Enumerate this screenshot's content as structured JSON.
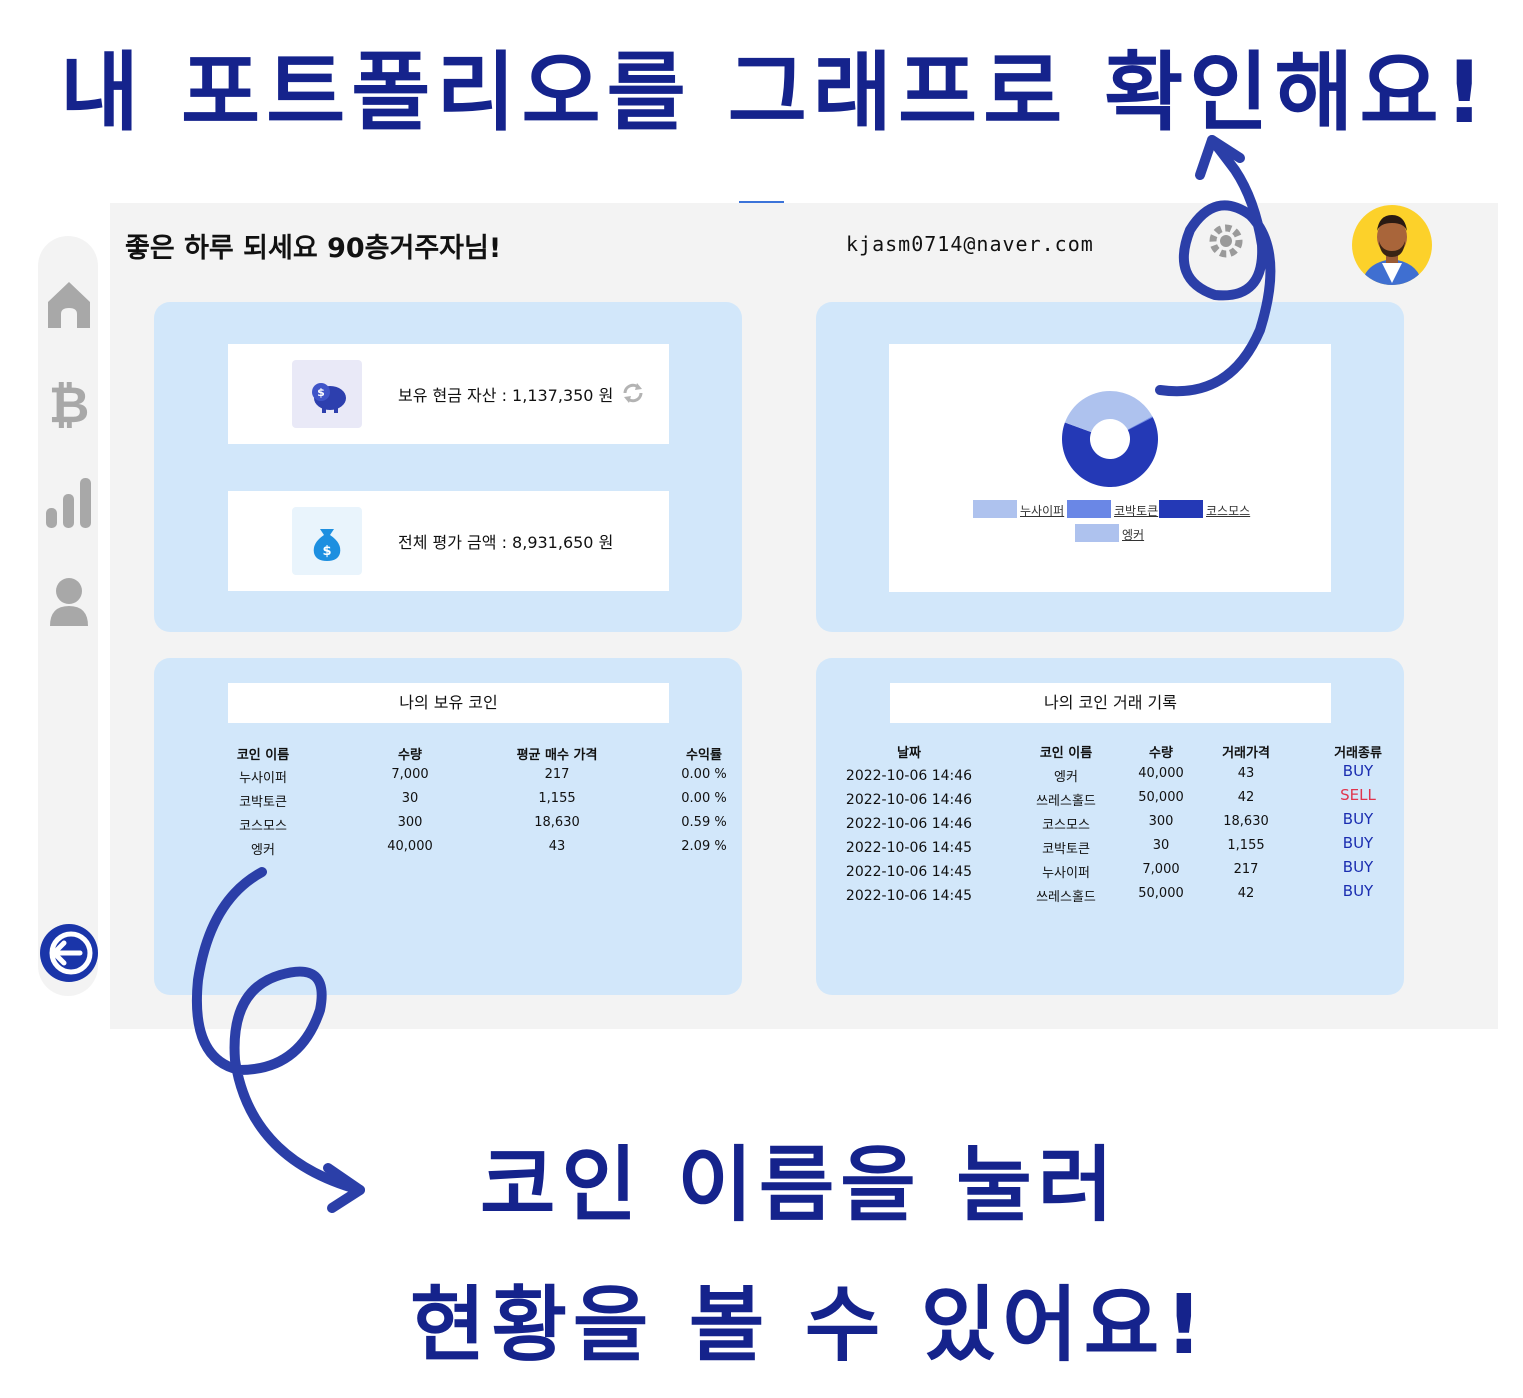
{
  "headlines": {
    "top": "내 포트폴리오를 그래프로 확인해요!",
    "bottom_line1": "코인 이름을 눌러",
    "bottom_line2": "현황을 볼 수 있어요!"
  },
  "header": {
    "greeting": "좋은 하루 되세요 90층거주자님!",
    "email": "kjasm0714@naver.com"
  },
  "sidebar": {
    "items": [
      {
        "icon": "home-icon"
      },
      {
        "icon": "bitcoin-icon"
      },
      {
        "icon": "bar-chart-icon"
      },
      {
        "icon": "user-icon"
      }
    ],
    "logout_icon": "arrow-left-icon"
  },
  "assets": {
    "cash": "보유 현금 자산 : 1,137,350 원",
    "evaluation": "전체 평가 금액 : 8,931,650 원"
  },
  "chart_data": {
    "type": "pie",
    "style": "donut",
    "legend_position": "bottom",
    "labels": [
      "누사이퍼",
      "코박토큰",
      "코스모스",
      "엥커"
    ],
    "values": [
      1519000,
      34650,
      5589000,
      1720000
    ],
    "colors": [
      "#aec2ee",
      "#6a87e6",
      "#2439b6",
      "#aec2ee"
    ]
  },
  "holdings": {
    "title": "나의 보유 코인",
    "columns": [
      "코인 이름",
      "수량",
      "평균 매수 가격",
      "수익률"
    ],
    "rows": [
      [
        "누사이퍼",
        "7,000",
        "217",
        "0.00 %"
      ],
      [
        "코박토큰",
        "30",
        "1,155",
        "0.00 %"
      ],
      [
        "코스모스",
        "300",
        "18,630",
        "0.59 %"
      ],
      [
        "엥커",
        "40,000",
        "43",
        "2.09 %"
      ]
    ]
  },
  "history": {
    "title": "나의 코인 거래 기록",
    "columns": [
      "날짜",
      "코인 이름",
      "수량",
      "거래가격",
      "거래종류"
    ],
    "rows": [
      [
        "2022-10-06 14:46",
        "엥커",
        "40,000",
        "43",
        "BUY"
      ],
      [
        "2022-10-06 14:46",
        "쓰레스홀드",
        "50,000",
        "42",
        "SELL"
      ],
      [
        "2022-10-06 14:46",
        "코스모스",
        "300",
        "18,630",
        "BUY"
      ],
      [
        "2022-10-06 14:45",
        "코박토큰",
        "30",
        "1,155",
        "BUY"
      ],
      [
        "2022-10-06 14:45",
        "누사이퍼",
        "7,000",
        "217",
        "BUY"
      ],
      [
        "2022-10-06 14:45",
        "쓰레스홀드",
        "50,000",
        "42",
        "BUY"
      ]
    ]
  },
  "colors": {
    "accent": "#15238c",
    "panel": "#d2e7fa",
    "buy": "#1a2db0",
    "sell": "#e0344d",
    "sidebar_icon": "#a8a8a8"
  }
}
